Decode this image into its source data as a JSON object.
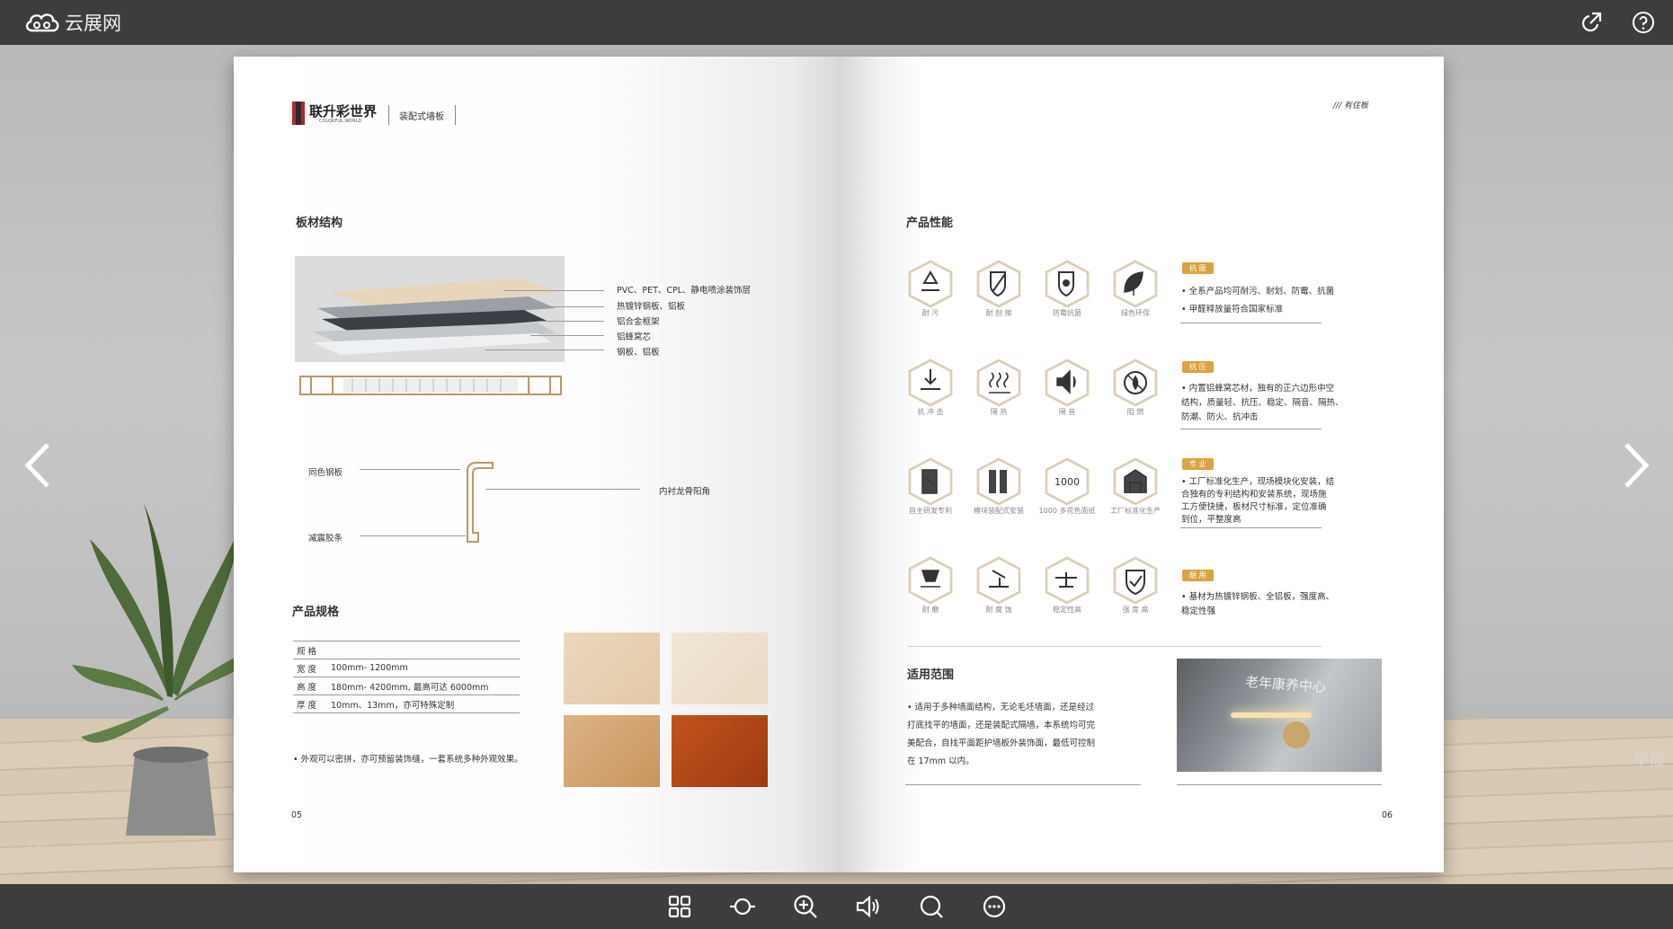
{
  "app": {
    "name": "云展网"
  },
  "topbar_icons": [
    "share-icon",
    "help-icon"
  ],
  "bottombar_icons": [
    "thumbnails-icon",
    "autoplay-icon",
    "zoom-in-icon",
    "sound-icon",
    "search-icon",
    "more-icon"
  ],
  "report_label": "举报",
  "left_page": {
    "brand": "联升彩世界",
    "brand_sub": "COLORFUL WORLD",
    "header_tag": "装配式墙板",
    "section1_title": "板材结构",
    "layers": [
      "PVC、PET、CPL、静电喷涂装饰层",
      "热镀锌钢板、铝板",
      "铝合金框架",
      "铝蜂窝芯",
      "钢板、铝板"
    ],
    "corner_labels": {
      "top": "同色钢板",
      "bottom": "减震胶条",
      "right": "内衬龙骨阳角"
    },
    "section2_title": "产品规格",
    "spec_rows": [
      {
        "k": "规 格",
        "v": ""
      },
      {
        "k": "宽 度",
        "v": "100mm- 1200mm"
      },
      {
        "k": "高 度",
        "v": "180mm- 4200mm, 最高可达 6000mm"
      },
      {
        "k": "厚 度",
        "v": "10mm、13mm，亦可特殊定制"
      }
    ],
    "note": "• 外观可以密拼，亦可预留装饰缝，一套系统多种外观效果。",
    "page_number": "05"
  },
  "right_page": {
    "header_tag": "/// 有住板",
    "section_title": "产品性能",
    "icon_rows": [
      {
        "tag": "抗 菌",
        "icons": [
          {
            "label": "耐 污",
            "icon": "drop-icon"
          },
          {
            "label": "耐 刮 擦",
            "icon": "shield-icon"
          },
          {
            "label": "防霉抗菌",
            "icon": "bacteria-icon"
          },
          {
            "label": "绿色环保",
            "icon": "leaf-icon"
          }
        ],
        "desc": [
          "• 全系产品均可耐污、耐划、防霉、抗菌",
          "• 甲醛释放量符合国家标准"
        ]
      },
      {
        "tag": "抗 压",
        "icons": [
          {
            "label": "抗 冲 击",
            "icon": "impact-icon"
          },
          {
            "label": "隔 热",
            "icon": "heat-icon"
          },
          {
            "label": "隔 音",
            "icon": "speaker-icon"
          },
          {
            "label": "阻 燃",
            "icon": "fire-icon"
          }
        ],
        "desc": [
          "• 内置铝蜂窝芯材，独有的正六边形中空",
          "结构，质量轻、抗压、稳定、隔音、隔热、",
          "防潮、防火、抗冲击"
        ]
      },
      {
        "tag": "专 业",
        "icons": [
          {
            "label": "自主研发专利",
            "icon": "patent-icon"
          },
          {
            "label": "模块装配式安装",
            "icon": "module-icon"
          },
          {
            "label": "1000 多花色面纸",
            "icon": "count-icon"
          },
          {
            "label": "工厂标准化生产",
            "icon": "factory-icon"
          }
        ],
        "desc": [
          "• 工厂标准化生产，现场模块化安装，结",
          "合独有的专利结构和安装系统，现场施",
          "工方便快捷，板材尺寸标准，定位准确",
          "到位，平整度高"
        ]
      },
      {
        "tag": "耐 用",
        "icons": [
          {
            "label": "耐 磨",
            "icon": "wear-icon"
          },
          {
            "label": "耐 腐 蚀",
            "icon": "corrosion-icon"
          },
          {
            "label": "稳定性高",
            "icon": "stable-icon"
          },
          {
            "label": "强 度 高",
            "icon": "strength-icon"
          }
        ],
        "desc": [
          "• 基材为热镀锌钢板、全铝板，强度高、",
          "稳定性强"
        ]
      }
    ],
    "count_text": "1000",
    "scope_title": "适用范围",
    "scope_text": [
      "• 适用于多种墙面结构，无论毛坯墙面，还是经过",
      "打底找平的墙面，还是装配式隔墙，本系统均可完",
      "美配合，自找平面距护墙板外装饰面，最低可控制",
      "在 17mm 以内。"
    ],
    "photo_sign": "老年康养中心",
    "page_number": "06"
  },
  "colors": {
    "bar": "#3d3d3d",
    "accent": "#d9a441"
  }
}
